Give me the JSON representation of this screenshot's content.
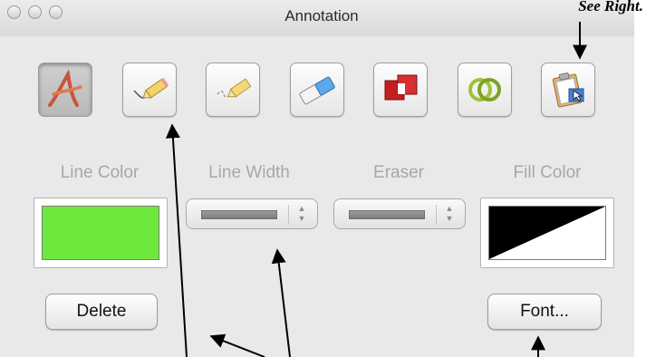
{
  "window": {
    "title": "Annotation"
  },
  "callout": {
    "text": "See Right."
  },
  "toolbar": {
    "tools": [
      {
        "name": "text-tool",
        "icon": "text-a-icon",
        "active": true
      },
      {
        "name": "pencil-tool",
        "icon": "pencil-icon",
        "active": false
      },
      {
        "name": "highlighter-tool",
        "icon": "highlighter-icon",
        "active": false
      },
      {
        "name": "eraser-tool",
        "icon": "eraser-icon",
        "active": false
      },
      {
        "name": "shape-tool",
        "icon": "shapes-icon",
        "active": false
      },
      {
        "name": "ring-tool",
        "icon": "rings-icon",
        "active": false
      },
      {
        "name": "clipboard-tool",
        "icon": "clipboard-pointer-icon",
        "active": false
      }
    ]
  },
  "controls": {
    "line_color_label": "Line Color",
    "line_width_label": "Line Width",
    "eraser_label": "Eraser",
    "fill_color_label": "Fill Color",
    "line_color": "#6ee83d",
    "fill_colors": [
      "#000000",
      "#ffffff"
    ]
  },
  "buttons": {
    "delete_label": "Delete",
    "font_label": "Font..."
  }
}
